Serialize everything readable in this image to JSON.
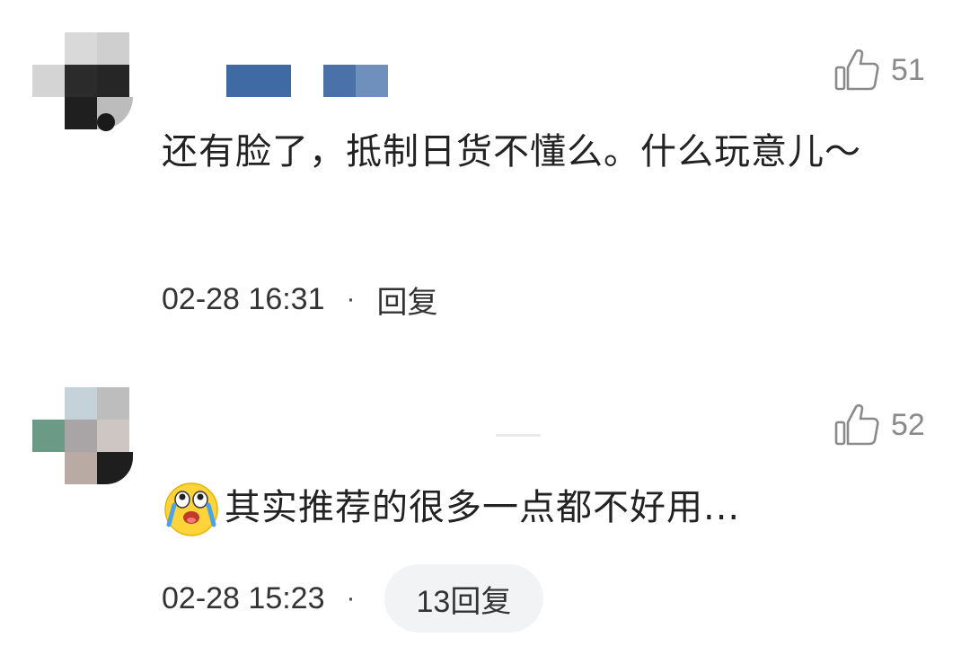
{
  "comments": [
    {
      "avatar_icon": "mosaic-avatar",
      "username_hidden": true,
      "likes": "51",
      "text": "还有脸了，抵制日货不懂么。什么玩意儿～",
      "timestamp": "02-28 16:31",
      "separator": "·",
      "reply_label": "回复"
    },
    {
      "avatar_icon": "mosaic-avatar",
      "username_hidden": true,
      "likes": "52",
      "emoji_icon": "crying-laughing-emoji",
      "text": "其实推荐的很多一点都不好用...",
      "timestamp": "02-28 15:23",
      "separator": "·",
      "reply_label": "13回复"
    }
  ],
  "colors": {
    "like_icon": "#8a8a8a",
    "reply_pill_bg": "#f2f3f5",
    "username_mosaic": "#3f6aa3"
  }
}
